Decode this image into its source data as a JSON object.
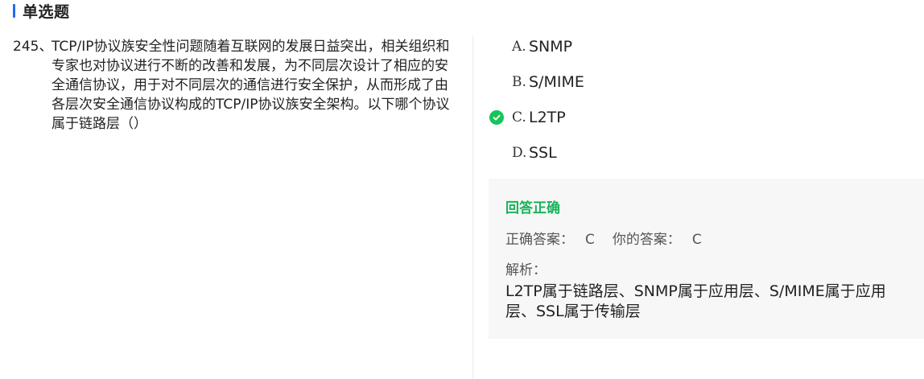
{
  "section": {
    "title": "单选题"
  },
  "question": {
    "number": "245、",
    "text": "TCP/IP协议族安全性问题随着互联网的发展日益突出，相关组织和专家也对协议进行不断的改善和发展，为不同层次设计了相应的安全通信协议，用于对不同层次的通信进行安全保护，从而形成了由各层次安全通信协议构成的TCP/IP协议族安全架构。以下哪个协议属于链路层（）"
  },
  "options": [
    {
      "letter": "A.",
      "text": "SNMP",
      "correct": false
    },
    {
      "letter": "B.",
      "text": "S/MIME",
      "correct": false
    },
    {
      "letter": "C.",
      "text": "L2TP",
      "correct": true
    },
    {
      "letter": "D.",
      "text": "SSL",
      "correct": false
    }
  ],
  "answer": {
    "result": "回答正确",
    "correct_label": "正确答案：",
    "correct_value": "C",
    "yours_label": "你的答案：",
    "yours_value": "C",
    "analysis_label": "解析：",
    "analysis_text": "L2TP属于链路层、SNMP属于应用层、S/MIME属于应用层、SSL属于传输层"
  },
  "colors": {
    "accent": "#1e6cf0",
    "correct": "#19c35b",
    "panel_bg": "#f7f7f7"
  },
  "icons": {
    "correct_option": "check-circle-icon"
  }
}
